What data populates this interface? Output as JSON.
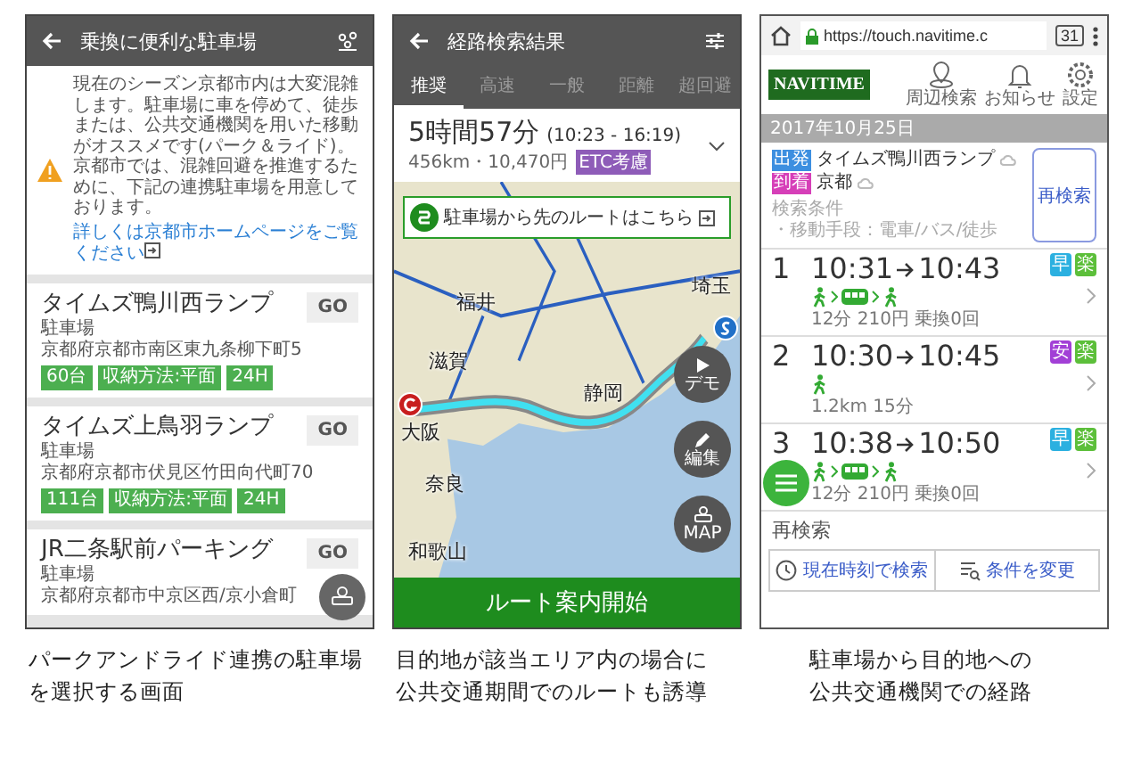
{
  "parking_screen": {
    "title": "乗換に便利な駐車場",
    "notice": {
      "text": "現在のシーズン京都市内は大変混雑します。駐車場に車を停めて、徒歩または、公共交通機関を用いた移動がオススメです(パーク＆ライド)。京都市では、混雑回避を推進するために、下記の連携駐車場を用意しております。",
      "link": "詳しくは京都市ホームページをご覧ください"
    },
    "lots": [
      {
        "name": "タイムズ鴨川西ランプ",
        "type": "駐車場",
        "address": "京都府京都市南区東九条柳下町5",
        "tags": [
          "60台",
          "収納方法:平面",
          "24H"
        ],
        "button": "GO"
      },
      {
        "name": "タイムズ上鳥羽ランプ",
        "type": "駐車場",
        "address": "京都府京都市伏見区竹田向代町70",
        "tags": [
          "111台",
          "収納方法:平面",
          "24H"
        ],
        "button": "GO"
      },
      {
        "name": "JR二条駅前パーキング",
        "type": "駐車場",
        "address": "京都府京都市中京区西/京小倉町",
        "button": "GO"
      }
    ]
  },
  "route_screen": {
    "title": "経路検索結果",
    "tabs": [
      {
        "label": "推奨",
        "selected": true
      },
      {
        "label": "高速",
        "selected": false
      },
      {
        "label": "一般",
        "selected": false
      },
      {
        "label": "距離",
        "selected": false
      },
      {
        "label": "超回避",
        "selected": false
      }
    ],
    "summary": {
      "duration": "5時間57分",
      "time_range": "(10:23 - 16:19)",
      "distance_fare": "456km・10,470円",
      "badge": "ETC考慮"
    },
    "banner": "駐車場から先のルートはこちら",
    "map_labels": [
      "福井",
      "滋賀",
      "大阪",
      "奈良",
      "和歌山",
      "静岡",
      "埼玉"
    ],
    "map_buttons": [
      {
        "label": "デモ",
        "kind": "play"
      },
      {
        "label": "編集",
        "kind": "edit"
      },
      {
        "label": "MAP",
        "kind": "parking"
      }
    ],
    "start_button": "ルート案内開始"
  },
  "transit_screen": {
    "url": "https://touch.navitime.c",
    "tab_count": "31",
    "logo": "NAVITIME",
    "nav_items": [
      {
        "label": "周辺検索",
        "kind": "pin"
      },
      {
        "label": "お知らせ",
        "kind": "bell"
      },
      {
        "label": "設定",
        "kind": "gear"
      }
    ],
    "date": "2017年10月25日",
    "origin": {
      "tag": "出発",
      "name": "タイムズ鴨川西ランプ",
      "color": "#3d8fe0"
    },
    "destination": {
      "tag": "到着",
      "name": "京都",
      "color": "#d63fb8"
    },
    "conditions_label": "検索条件",
    "conditions": "・移動手段：電車/バス/徒歩",
    "research_button": "再検索",
    "routes": [
      {
        "index": "1",
        "depart": "10:31",
        "arrive": "10:43",
        "badges": [
          {
            "label": "早",
            "color": "#2bb0e0"
          },
          {
            "label": "楽",
            "color": "#5cbf3a"
          }
        ],
        "legs": [
          {
            "kind": "walk"
          },
          {
            "kind": "train"
          },
          {
            "kind": "walk"
          }
        ],
        "details": "12分  210円  乗換0回"
      },
      {
        "index": "2",
        "depart": "10:30",
        "arrive": "10:45",
        "badges": [
          {
            "label": "安",
            "color": "#a23fd6"
          },
          {
            "label": "楽",
            "color": "#5cbf3a"
          }
        ],
        "legs": [
          {
            "kind": "walk"
          }
        ],
        "details": "1.2km  15分"
      },
      {
        "index": "3",
        "depart": "10:38",
        "arrive": "10:50",
        "badges": [
          {
            "label": "早",
            "color": "#2bb0e0"
          },
          {
            "label": "楽",
            "color": "#5cbf3a"
          }
        ],
        "legs": [
          {
            "kind": "walk"
          },
          {
            "kind": "train"
          },
          {
            "kind": "walk"
          }
        ],
        "details": "12分  210円  乗換0回"
      }
    ],
    "research_heading": "再検索",
    "actions": [
      {
        "label": "現在時刻で検索",
        "kind": "clock"
      },
      {
        "label": "条件を変更",
        "kind": "filter"
      }
    ]
  },
  "captions": [
    "パークアンドライド連携の駐車場を選択する画面",
    "目的地が該当エリア内の場合に公共交通期間でのルートも誘導",
    "駐車場から目的地への公共交通機関での経路"
  ]
}
